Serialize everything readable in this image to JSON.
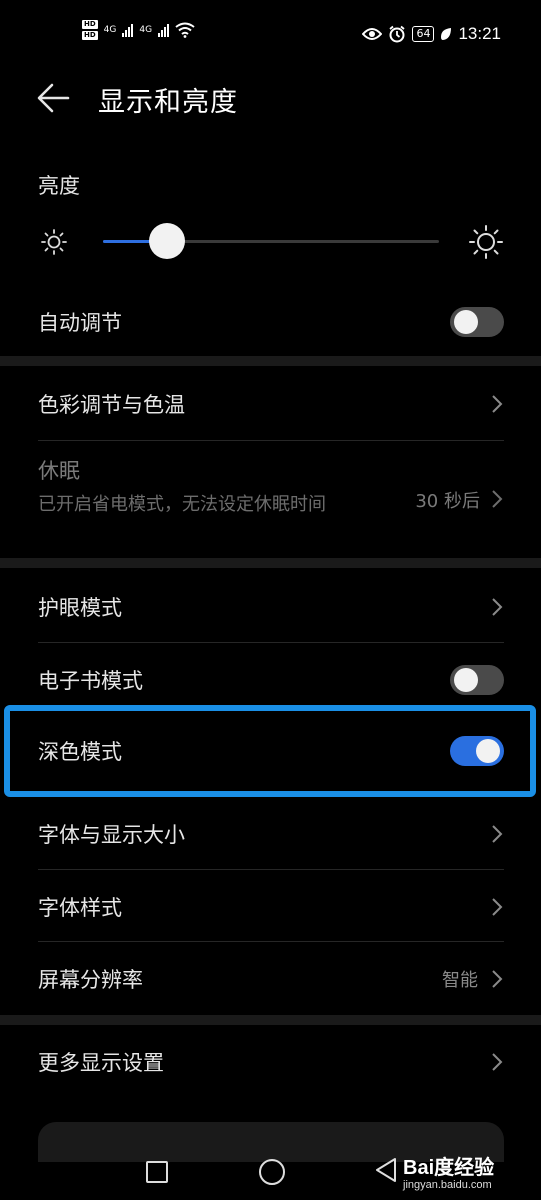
{
  "status_bar": {
    "network_badges": [
      "HD",
      "HD"
    ],
    "signal_labels": [
      "4G",
      "4G"
    ],
    "battery": "64",
    "time": "13:21"
  },
  "header": {
    "title": "显示和亮度"
  },
  "brightness": {
    "section_label": "亮度",
    "level": 0.19
  },
  "auto_adjust": {
    "label": "自动调节",
    "enabled": false
  },
  "color_temp": {
    "label": "色彩调节与色温"
  },
  "sleep": {
    "title": "休眠",
    "subtitle": "已开启省电模式，无法设定休眠时间",
    "value": "30 秒后"
  },
  "eye_comfort": {
    "label": "护眼模式"
  },
  "ebook_mode": {
    "label": "电子书模式",
    "enabled": false
  },
  "dark_mode": {
    "label": "深色模式",
    "enabled": true
  },
  "font_size": {
    "label": "字体与显示大小"
  },
  "font_style": {
    "label": "字体样式"
  },
  "resolution": {
    "label": "屏幕分辨率",
    "value": "智能"
  },
  "more_settings": {
    "label": "更多显示设置"
  },
  "watermark": {
    "brand": "Bai度经验",
    "url": "jingyan.baidu.com"
  },
  "colors": {
    "accent": "#2a6fe0",
    "highlight": "#1a8fe6",
    "background": "#000000"
  }
}
